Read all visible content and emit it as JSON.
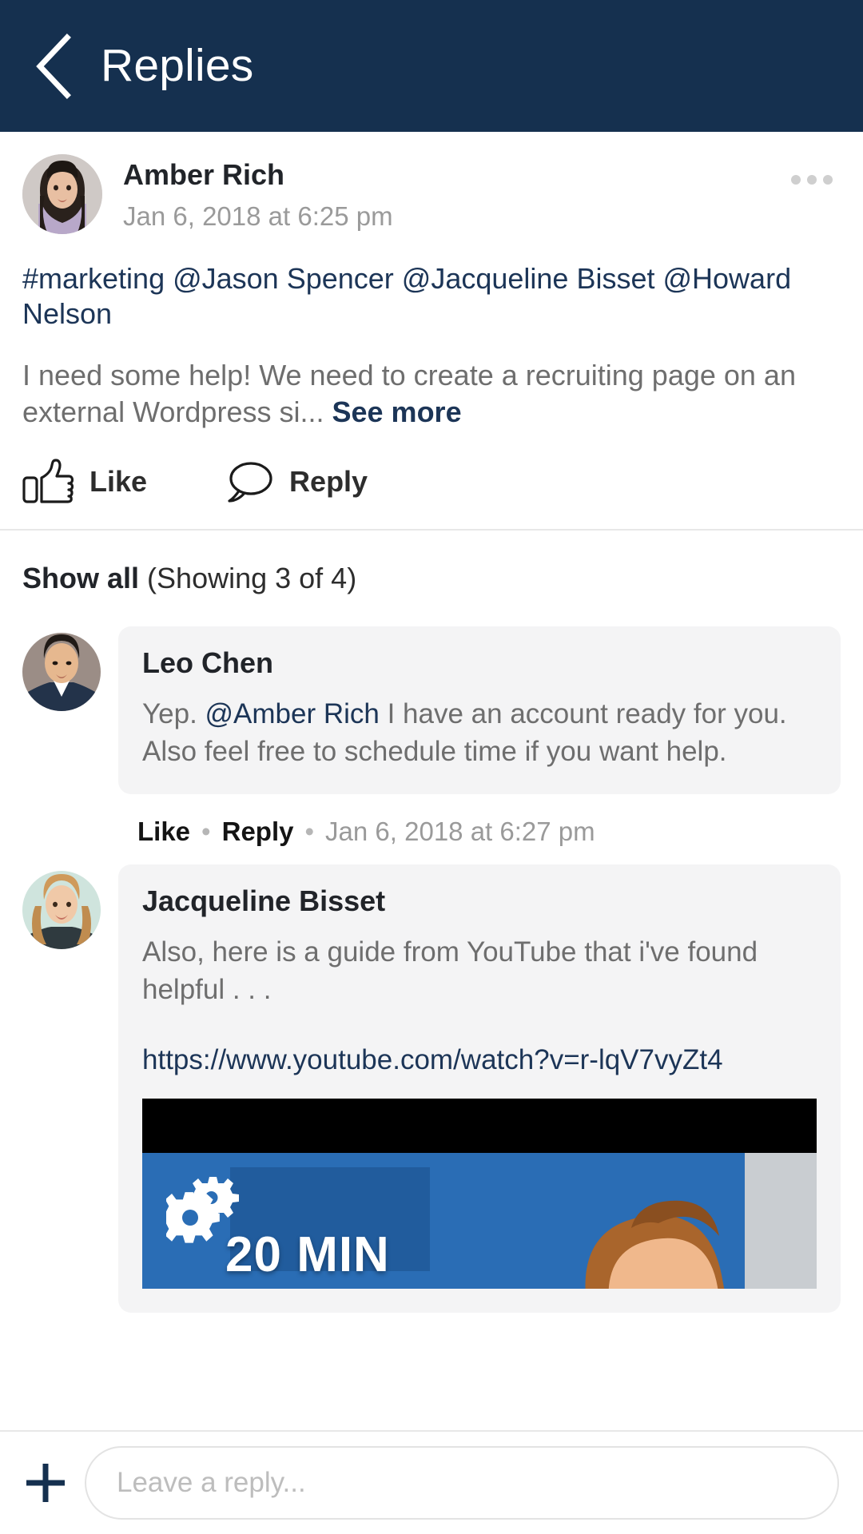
{
  "header": {
    "title": "Replies",
    "back_icon": "chevron-left-icon",
    "background_color": "#15304f"
  },
  "post": {
    "author": "Amber Rich",
    "timestamp": "Jan 6, 2018 at 6:25 pm",
    "tags_line": "#marketing @Jason Spencer @Jacqueline Bisset @Howard Nelson",
    "body": "I need some help! We need to create a recruiting page on an external Wordpress si...",
    "see_more_label": "See more",
    "more_menu_icon": "more-horizontal-icon",
    "actions": {
      "like_label": "Like",
      "like_icon": "thumbs-up-icon",
      "reply_label": "Reply",
      "reply_icon": "speech-bubble-icon"
    }
  },
  "show_all": {
    "link_label": "Show all",
    "count_label": "(Showing 3 of 4)"
  },
  "replies": [
    {
      "author": "Leo Chen",
      "text_before_mention": "Yep. ",
      "mention": "@Amber Rich",
      "text_after_mention": " I have an account ready for you.  Also feel free to schedule time if you want help.",
      "like_label": "Like",
      "reply_label": "Reply",
      "separator": "•",
      "timestamp": "Jan 6, 2018 at 6:27 pm"
    },
    {
      "author": "Jacqueline Bisset",
      "text": "Also, here is a guide from YouTube that i've found helpful . . .",
      "link": "https://www.youtube.com/watch?v=r-lqV7vyZt4",
      "video_thumbnail": {
        "title": "20 MIN",
        "icon": "gears-icon",
        "background_color": "#2a6db5"
      }
    }
  ],
  "composer": {
    "add_icon": "plus-icon",
    "input_placeholder": "Leave a reply...",
    "input_value": ""
  },
  "colors": {
    "header_navy": "#15304f",
    "link_navy": "#1c3557",
    "body_gray": "#6e6e6e",
    "meta_gray": "#9a9a9a",
    "bubble_gray": "#f4f4f5"
  }
}
